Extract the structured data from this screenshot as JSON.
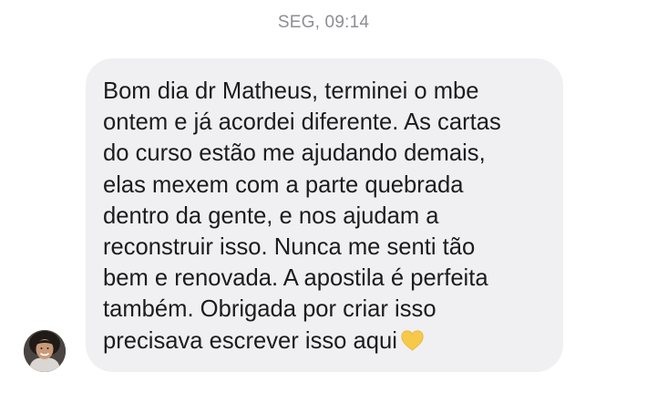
{
  "header": {
    "timestamp": "SEG, 09:14"
  },
  "message": {
    "lines": "Bom dia dr Matheus, terminei o mbe\nontem e já acordei diferente. As cartas\ndo curso estão me ajudando demais,\nelas mexem com a parte quebrada\ndentro da gente, e nos ajudam a\nreconstruir isso. Nunca me senti tão\nbem e renovada. A apostila é perfeita\ntambém. Obrigada por criar isso\nprecisava escrever isso aqui",
    "emoji_icon": "yellow-heart-icon",
    "bubble_color": "#f0f0f2",
    "text_color": "#1c1c1e"
  },
  "sender": {
    "avatar_icon": "profile-photo"
  },
  "colors": {
    "timestamp": "#8e8e93",
    "heart": "#f7c948"
  }
}
